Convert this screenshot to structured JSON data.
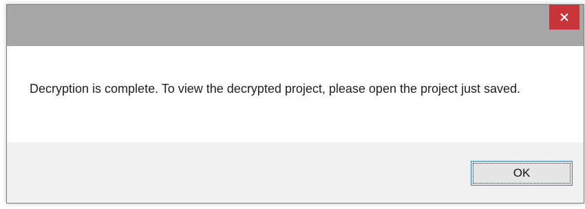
{
  "dialog": {
    "message": "Decryption is complete. To view the decrypted project, please open the project just saved.",
    "ok_label": "OK",
    "close_icon": "close-icon"
  },
  "colors": {
    "titlebar": "#a6a6a6",
    "close_button": "#c7343a",
    "footer": "#f0f0f0",
    "ok_border": "#3c7fb1"
  }
}
